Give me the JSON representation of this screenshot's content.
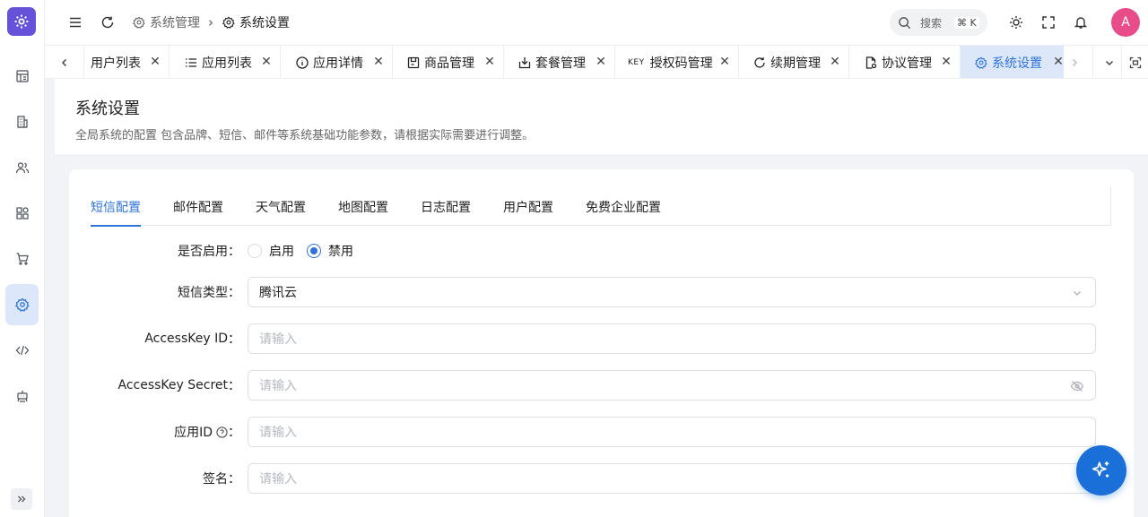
{
  "app": {
    "avatar_letter": "A",
    "accent_color": "#2f73d9",
    "logo_color": "#6552d9"
  },
  "sidebar": {
    "items": [
      {
        "icon": "dashboard-icon",
        "active": false
      },
      {
        "icon": "building-icon",
        "active": false
      },
      {
        "icon": "users-icon",
        "active": false
      },
      {
        "icon": "apps-icon",
        "active": false
      },
      {
        "icon": "cart-icon",
        "active": false
      },
      {
        "icon": "gear-icon",
        "active": true
      },
      {
        "icon": "code-icon",
        "active": false
      },
      {
        "icon": "robot-icon",
        "active": false
      }
    ]
  },
  "header": {
    "breadcrumb": [
      "系统管理",
      "系统设置"
    ],
    "search_placeholder": "搜索",
    "search_shortcut": "⌘ K"
  },
  "tabs": [
    {
      "label": "用户列表",
      "icon": "none",
      "active": false
    },
    {
      "label": "应用列表",
      "icon": "list-icon",
      "active": false
    },
    {
      "label": "应用详情",
      "icon": "info-icon",
      "active": false
    },
    {
      "label": "商品管理",
      "icon": "product-icon",
      "active": false
    },
    {
      "label": "套餐管理",
      "icon": "package-icon",
      "active": false
    },
    {
      "label": "授权码管理",
      "icon": "key-icon",
      "key_text": "KEY",
      "active": false
    },
    {
      "label": "续期管理",
      "icon": "refresh-icon",
      "active": false
    },
    {
      "label": "协议管理",
      "icon": "document-icon",
      "active": false
    },
    {
      "label": "系统设置",
      "icon": "gear-icon",
      "active": true
    }
  ],
  "page": {
    "title": "系统设置",
    "description": "全局系统的配置 包含品牌、短信、邮件等系统基础功能参数，请根据实际需要进行调整。"
  },
  "config_tabs": [
    {
      "label": "短信配置",
      "active": true
    },
    {
      "label": "邮件配置",
      "active": false
    },
    {
      "label": "天气配置",
      "active": false
    },
    {
      "label": "地图配置",
      "active": false
    },
    {
      "label": "日志配置",
      "active": false
    },
    {
      "label": "用户配置",
      "active": false
    },
    {
      "label": "免费企业配置",
      "active": false
    }
  ],
  "form": {
    "enabled": {
      "label": "是否启用",
      "options": [
        {
          "label": "启用",
          "checked": false
        },
        {
          "label": "禁用",
          "checked": true
        }
      ]
    },
    "sms_type": {
      "label": "短信类型",
      "value": "腾讯云"
    },
    "access_key_id": {
      "label": "AccessKey ID",
      "value": "",
      "placeholder": "请输入"
    },
    "access_key_secret": {
      "label": "AccessKey Secret",
      "value": "",
      "placeholder": "请输入"
    },
    "app_id": {
      "label": "应用ID",
      "value": "",
      "placeholder": "请输入"
    },
    "signature": {
      "label": "签名",
      "value": "",
      "placeholder": "请输入"
    }
  }
}
